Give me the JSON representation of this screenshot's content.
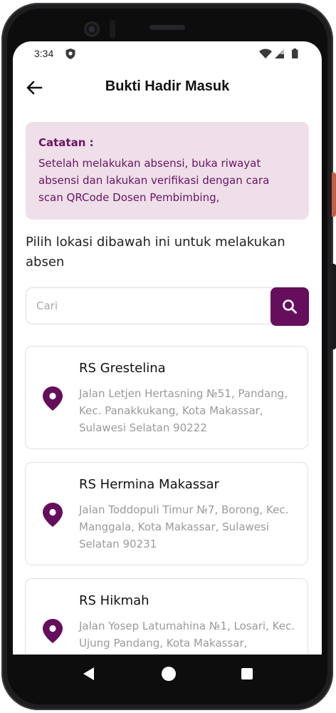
{
  "status_bar": {
    "time": "3:34",
    "icons": [
      "shield-icon",
      "wifi-icon",
      "signal-icon",
      "battery-icon"
    ]
  },
  "app_bar": {
    "title": "Bukti Hadir Masuk",
    "back_icon": "arrow-left-icon"
  },
  "note": {
    "title": "Catatan :",
    "body": "Setelah melakukan absensi, buka riwayat absensi dan lakukan verifikasi dengan cara scan QRCode Dosen Pembimbing,"
  },
  "instruction": "Pilih lokasi dibawah ini untuk melakukan absen",
  "search": {
    "placeholder": "Cari",
    "value": "",
    "button_icon": "search-icon"
  },
  "locations": [
    {
      "name": "RS Grestelina",
      "address": "Jalan Letjen Hertasning №51, Pandang, Kec. Panakkukang, Kota Makassar, Sulawesi Selatan 90222"
    },
    {
      "name": "RS Hermina Makassar",
      "address": "Jalan Toddopuli Timur №7, Borong, Kec. Manggala, Kota Makassar, Sulawesi Selatan 90231"
    },
    {
      "name": "RS Hikmah",
      "address": "Jalan Yosep Latumahina №1, Losari, Kec. Ujung Pandang, Kota Makassar,"
    }
  ],
  "nav_bar": {
    "icons": [
      "nav-back-icon",
      "nav-home-icon",
      "nav-recents-icon"
    ]
  },
  "colors": {
    "primary": "#650e5c",
    "note_background": "#eedfe9",
    "note_text": "#6a1462",
    "address_text": "#9a9a9a"
  }
}
